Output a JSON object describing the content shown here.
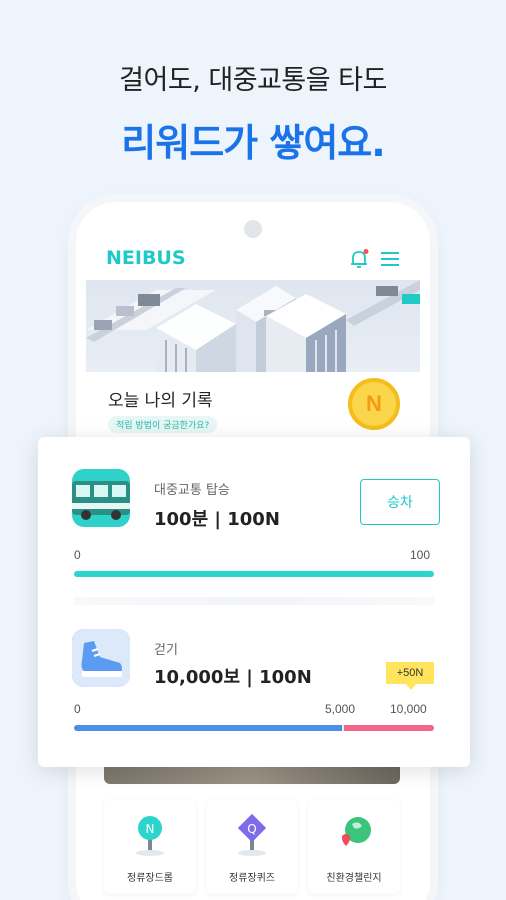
{
  "headline": {
    "line1": "걸어도, 대중교통을 타도",
    "line2": "리워드가 쌓여요."
  },
  "app": {
    "logo": "NEIBUS",
    "accent_color": "#1fc9c8",
    "icons": [
      "bell-icon",
      "menu-icon"
    ]
  },
  "record": {
    "title": "오늘 나의 기록",
    "pill": "적립 방법이 궁금한가요?",
    "coin_letter": "N"
  },
  "transit": {
    "label": "대중교통 탑승",
    "value": "100분 | 100N",
    "button": "승차",
    "scale_min": "0",
    "scale_max": "100",
    "progress": 1.0
  },
  "walking": {
    "label": "걷기",
    "value": "10,000보 | 100N",
    "badge": "+50N",
    "scale_min": "0",
    "scale_mid": "5,000",
    "scale_max": "10,000",
    "progress_primary": 0.75,
    "progress_bonus": 0.25
  },
  "tiles": [
    {
      "label": "정류장드롭",
      "icon": "bus-stop-drop-icon"
    },
    {
      "label": "정류장퀴즈",
      "icon": "bus-stop-quiz-icon"
    },
    {
      "label": "친환경챌린지",
      "icon": "eco-challenge-icon"
    }
  ]
}
